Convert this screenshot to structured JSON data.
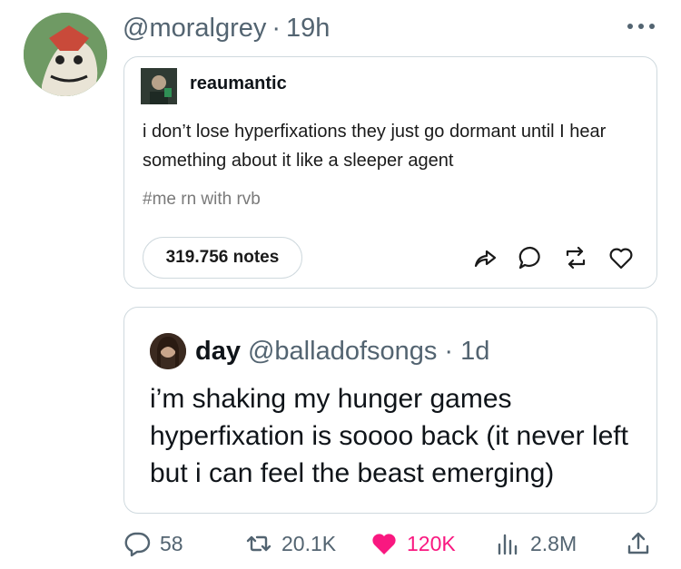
{
  "tweet": {
    "handle": "@moralgrey",
    "dot": "·",
    "time": "19h"
  },
  "tumblr": {
    "username": "reaumantic",
    "text": "i don’t lose hyperfixations they just go dormant until I hear something about it like a sleeper agent",
    "tag": "#me rn with rvb",
    "notes": "319.756 notes"
  },
  "quote": {
    "name": "day",
    "handle": "@balladofsongs",
    "dot": "·",
    "time": "1d",
    "text": "i’m shaking my hunger games hyperfixation is soooo back (it never left but i can feel the beast emerging)"
  },
  "actions": {
    "replies": "58",
    "reposts": "20.1K",
    "likes": "120K",
    "views": "2.8M"
  },
  "colors": {
    "muted": "#536471",
    "like": "#f91880",
    "border": "#cfd9de"
  }
}
